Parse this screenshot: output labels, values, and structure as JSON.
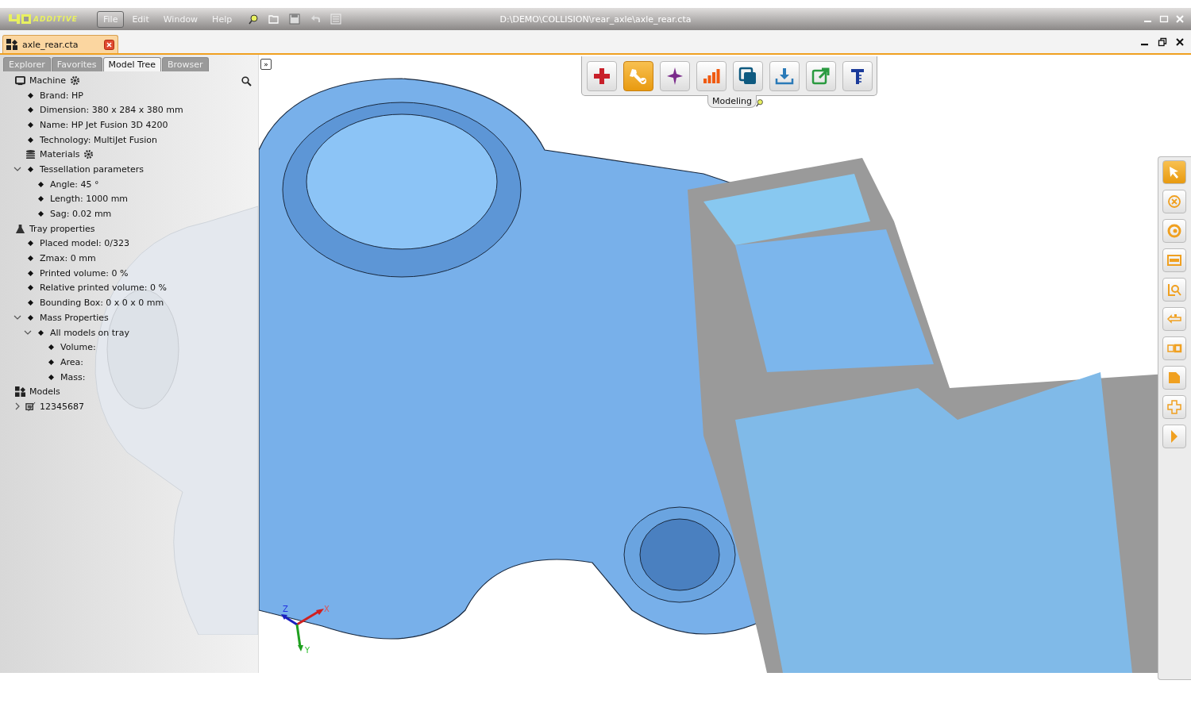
{
  "app": {
    "logo": "ADDITIVE",
    "menu": [
      {
        "label": "File",
        "selected": true
      },
      {
        "label": "Edit",
        "selected": false
      },
      {
        "label": "Window",
        "selected": false
      },
      {
        "label": "Help",
        "selected": false
      }
    ]
  },
  "window": {
    "title": "D:\\DEMO\\COLLISION\\rear_axle\\axle_rear.cta"
  },
  "document_tab": {
    "label": "axle_rear.cta"
  },
  "panel_tabs": [
    {
      "label": "Explorer",
      "selected": false
    },
    {
      "label": "Favorites",
      "selected": false
    },
    {
      "label": "Model Tree",
      "selected": true
    },
    {
      "label": "Browser",
      "selected": false
    }
  ],
  "collapse_button": "»",
  "tree": [
    {
      "kind": "machine",
      "label": "Machine",
      "settings": true,
      "children": [
        {
          "kind": "bullet",
          "label": "Brand: HP"
        },
        {
          "kind": "bullet",
          "label": "Dimension: 380 x 284 x 380 mm"
        },
        {
          "kind": "bullet",
          "label": "Name: HP Jet Fusion 3D 4200"
        },
        {
          "kind": "bullet",
          "label": "Technology: MultiJet Fusion"
        },
        {
          "kind": "materials",
          "label": "Materials",
          "settings": true
        },
        {
          "kind": "bullet",
          "label": "Tessellation parameters",
          "expanded": true,
          "children": [
            {
              "kind": "bullet",
              "label": "Angle: 45 °"
            },
            {
              "kind": "bullet",
              "label": "Length: 1000 mm"
            },
            {
              "kind": "bullet",
              "label": "Sag: 0.02 mm"
            }
          ]
        }
      ]
    },
    {
      "kind": "tray",
      "label": "Tray properties",
      "children": [
        {
          "kind": "bullet",
          "label": "Placed model: 0/323"
        },
        {
          "kind": "bullet",
          "label": "Zmax: 0 mm"
        },
        {
          "kind": "bullet",
          "label": "Printed volume: 0 %"
        },
        {
          "kind": "bullet",
          "label": "Relative printed volume: 0 %"
        },
        {
          "kind": "bullet",
          "label": "Bounding Box: 0 x 0 x 0 mm"
        },
        {
          "kind": "bullet",
          "label": "Mass Properties",
          "expanded": true,
          "children": [
            {
              "kind": "bullet",
              "label": "All models on tray",
              "expanded": true,
              "children": [
                {
                  "kind": "bullet",
                  "label": "Volume:"
                },
                {
                  "kind": "bullet",
                  "label": "Area:"
                },
                {
                  "kind": "bullet",
                  "label": "Mass:"
                }
              ]
            }
          ]
        }
      ]
    },
    {
      "kind": "models",
      "label": "Models",
      "children": [
        {
          "kind": "part",
          "label": "12345687",
          "expanded": false
        }
      ]
    }
  ],
  "ribbon": {
    "label": "Modeling",
    "buttons": [
      {
        "kind": "add",
        "selected": false
      },
      {
        "kind": "repair",
        "selected": true
      },
      {
        "kind": "star",
        "selected": false
      },
      {
        "kind": "bars",
        "selected": false
      },
      {
        "kind": "copy",
        "selected": false
      },
      {
        "kind": "download",
        "selected": false
      },
      {
        "kind": "export",
        "selected": false
      },
      {
        "kind": "caliper",
        "selected": false
      }
    ]
  },
  "side_toolbar": [
    {
      "kind": "pointer",
      "selected": true
    },
    {
      "kind": "cancel",
      "selected": false
    },
    {
      "kind": "ring",
      "selected": false
    },
    {
      "kind": "frame",
      "selected": false
    },
    {
      "kind": "inspect",
      "selected": false
    },
    {
      "kind": "swap",
      "selected": false
    },
    {
      "kind": "squares",
      "selected": false
    },
    {
      "kind": "corner",
      "selected": false
    },
    {
      "kind": "cross",
      "selected": false
    },
    {
      "kind": "half",
      "selected": false
    }
  ],
  "axes": {
    "x": "X",
    "y": "Y",
    "z": "Z"
  }
}
